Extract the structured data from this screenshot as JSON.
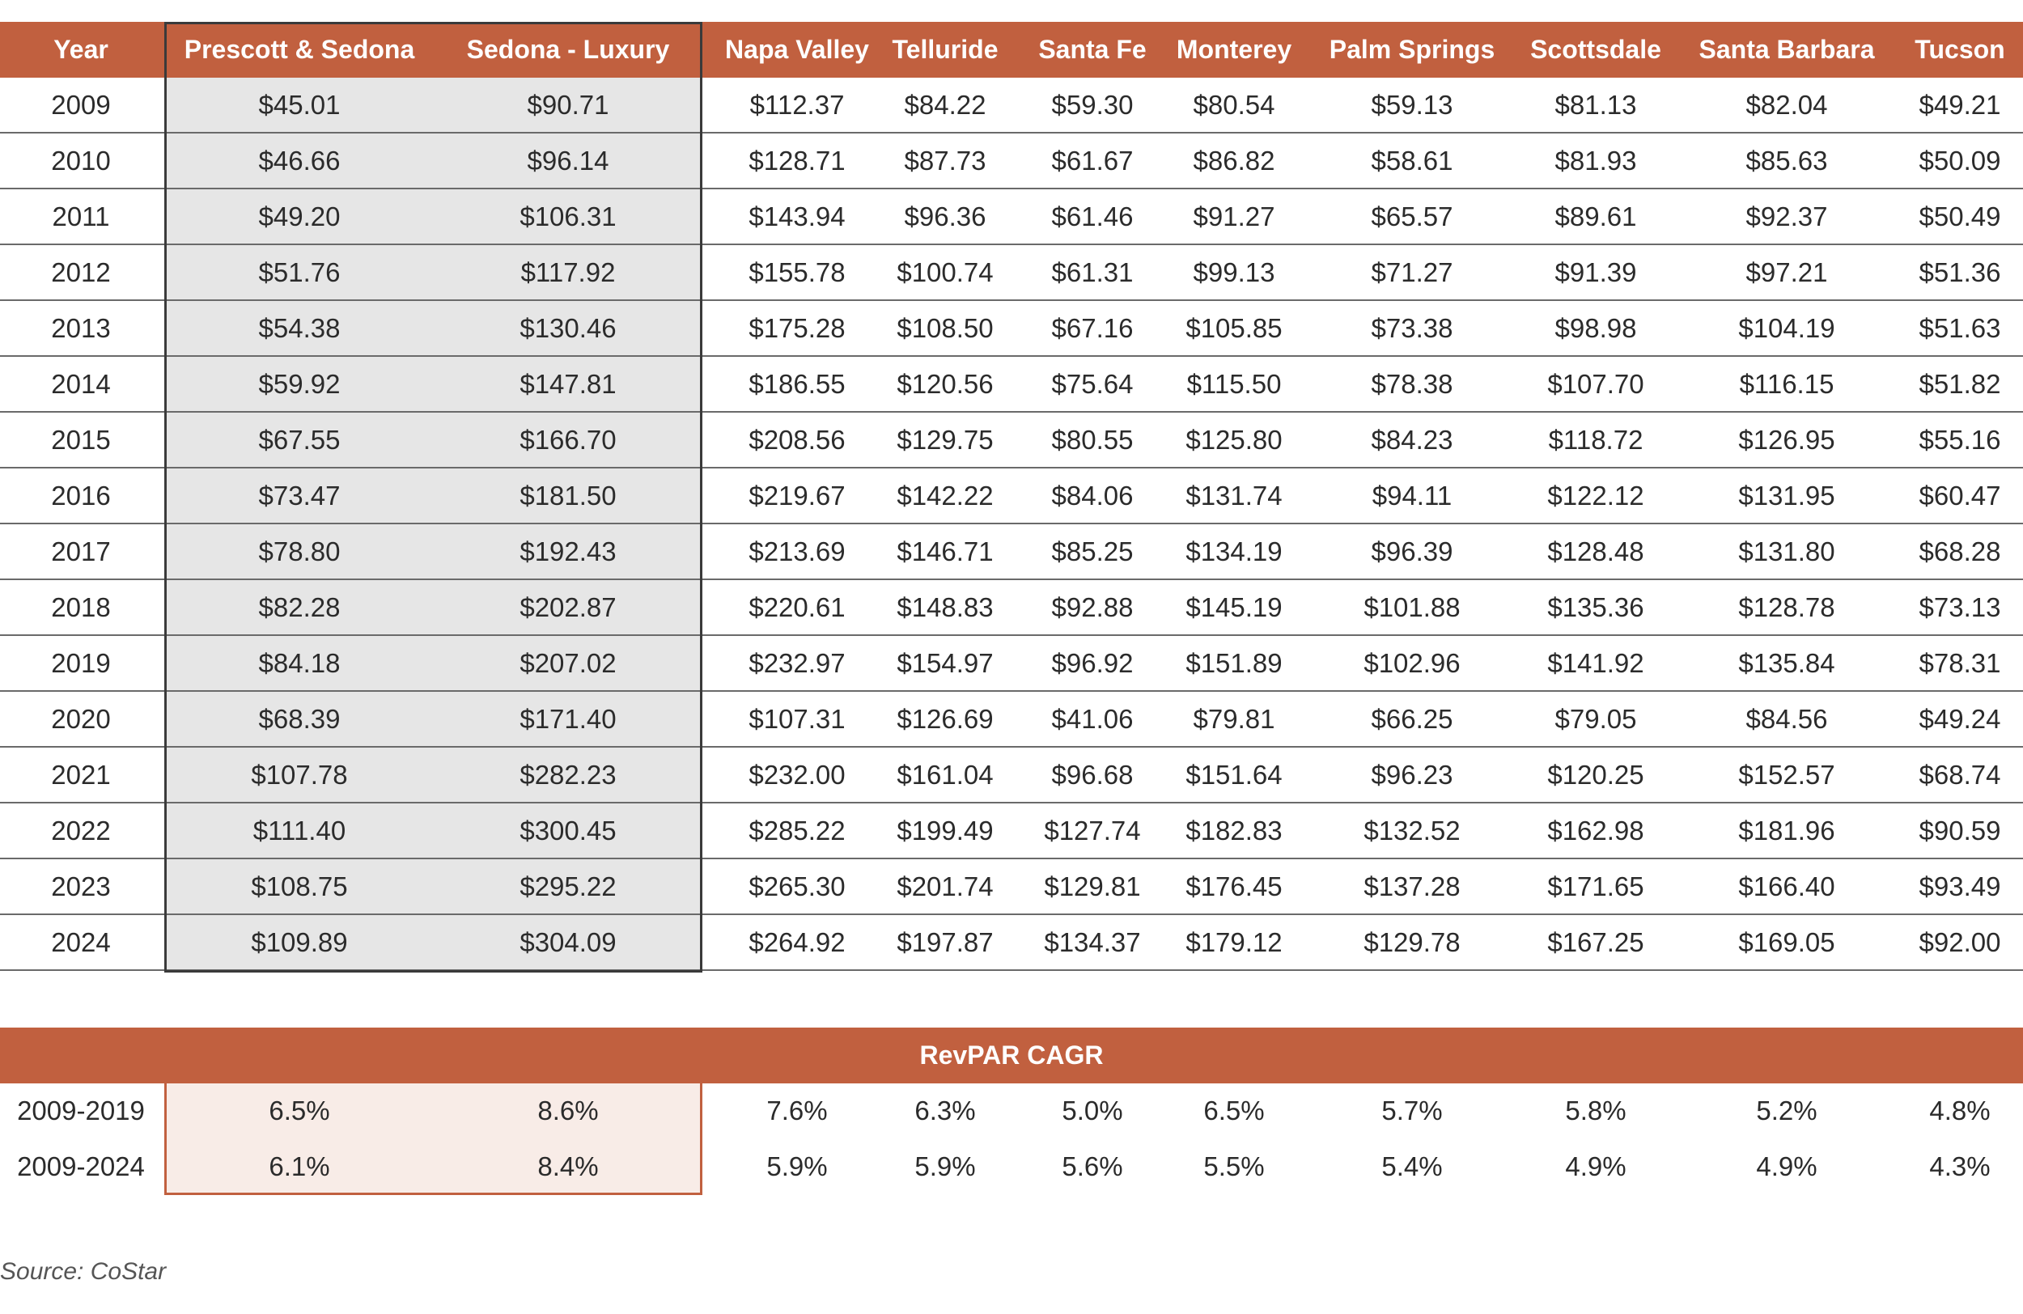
{
  "chart_data": {
    "type": "table",
    "columns": [
      "Year",
      "Prescott & Sedona",
      "Sedona - Luxury",
      "Napa Valley",
      "Telluride",
      "Santa Fe",
      "Monterey",
      "Palm Springs",
      "Scottsdale",
      "Santa Barbara",
      "Tucson"
    ],
    "rows": [
      [
        "2009",
        "$45.01",
        "$90.71",
        "$112.37",
        "$84.22",
        "$59.30",
        "$80.54",
        "$59.13",
        "$81.13",
        "$82.04",
        "$49.21"
      ],
      [
        "2010",
        "$46.66",
        "$96.14",
        "$128.71",
        "$87.73",
        "$61.67",
        "$86.82",
        "$58.61",
        "$81.93",
        "$85.63",
        "$50.09"
      ],
      [
        "2011",
        "$49.20",
        "$106.31",
        "$143.94",
        "$96.36",
        "$61.46",
        "$91.27",
        "$65.57",
        "$89.61",
        "$92.37",
        "$50.49"
      ],
      [
        "2012",
        "$51.76",
        "$117.92",
        "$155.78",
        "$100.74",
        "$61.31",
        "$99.13",
        "$71.27",
        "$91.39",
        "$97.21",
        "$51.36"
      ],
      [
        "2013",
        "$54.38",
        "$130.46",
        "$175.28",
        "$108.50",
        "$67.16",
        "$105.85",
        "$73.38",
        "$98.98",
        "$104.19",
        "$51.63"
      ],
      [
        "2014",
        "$59.92",
        "$147.81",
        "$186.55",
        "$120.56",
        "$75.64",
        "$115.50",
        "$78.38",
        "$107.70",
        "$116.15",
        "$51.82"
      ],
      [
        "2015",
        "$67.55",
        "$166.70",
        "$208.56",
        "$129.75",
        "$80.55",
        "$125.80",
        "$84.23",
        "$118.72",
        "$126.95",
        "$55.16"
      ],
      [
        "2016",
        "$73.47",
        "$181.50",
        "$219.67",
        "$142.22",
        "$84.06",
        "$131.74",
        "$94.11",
        "$122.12",
        "$131.95",
        "$60.47"
      ],
      [
        "2017",
        "$78.80",
        "$192.43",
        "$213.69",
        "$146.71",
        "$85.25",
        "$134.19",
        "$96.39",
        "$128.48",
        "$131.80",
        "$68.28"
      ],
      [
        "2018",
        "$82.28",
        "$202.87",
        "$220.61",
        "$148.83",
        "$92.88",
        "$145.19",
        "$101.88",
        "$135.36",
        "$128.78",
        "$73.13"
      ],
      [
        "2019",
        "$84.18",
        "$207.02",
        "$232.97",
        "$154.97",
        "$96.92",
        "$151.89",
        "$102.96",
        "$141.92",
        "$135.84",
        "$78.31"
      ],
      [
        "2020",
        "$68.39",
        "$171.40",
        "$107.31",
        "$126.69",
        "$41.06",
        "$79.81",
        "$66.25",
        "$79.05",
        "$84.56",
        "$49.24"
      ],
      [
        "2021",
        "$107.78",
        "$282.23",
        "$232.00",
        "$161.04",
        "$96.68",
        "$151.64",
        "$96.23",
        "$120.25",
        "$152.57",
        "$68.74"
      ],
      [
        "2022",
        "$111.40",
        "$300.45",
        "$285.22",
        "$199.49",
        "$127.74",
        "$182.83",
        "$132.52",
        "$162.98",
        "$181.96",
        "$90.59"
      ],
      [
        "2023",
        "$108.75",
        "$295.22",
        "$265.30",
        "$201.74",
        "$129.81",
        "$176.45",
        "$137.28",
        "$171.65",
        "$166.40",
        "$93.49"
      ],
      [
        "2024",
        "$109.89",
        "$304.09",
        "$264.92",
        "$197.87",
        "$134.37",
        "$179.12",
        "$129.78",
        "$167.25",
        "$169.05",
        "$92.00"
      ]
    ],
    "cagr_title": "RevPAR CAGR",
    "cagr_rows": [
      [
        "2009-2019",
        "6.5%",
        "8.6%",
        "7.6%",
        "6.3%",
        "5.0%",
        "6.5%",
        "5.7%",
        "5.8%",
        "5.2%",
        "4.8%"
      ],
      [
        "2009-2024",
        "6.1%",
        "8.4%",
        "5.9%",
        "5.9%",
        "5.6%",
        "5.5%",
        "5.4%",
        "4.9%",
        "4.9%",
        "4.3%"
      ]
    ],
    "source": "Source: CoStar",
    "highlighted_columns": [
      "Prescott & Sedona",
      "Sedona - Luxury"
    ],
    "colors": {
      "header": "#c1603f",
      "highlight_fill": "#e6e6e6",
      "highlight_border": "#3a3a3a",
      "cagr_highlight_fill": "#f8ece7"
    }
  }
}
